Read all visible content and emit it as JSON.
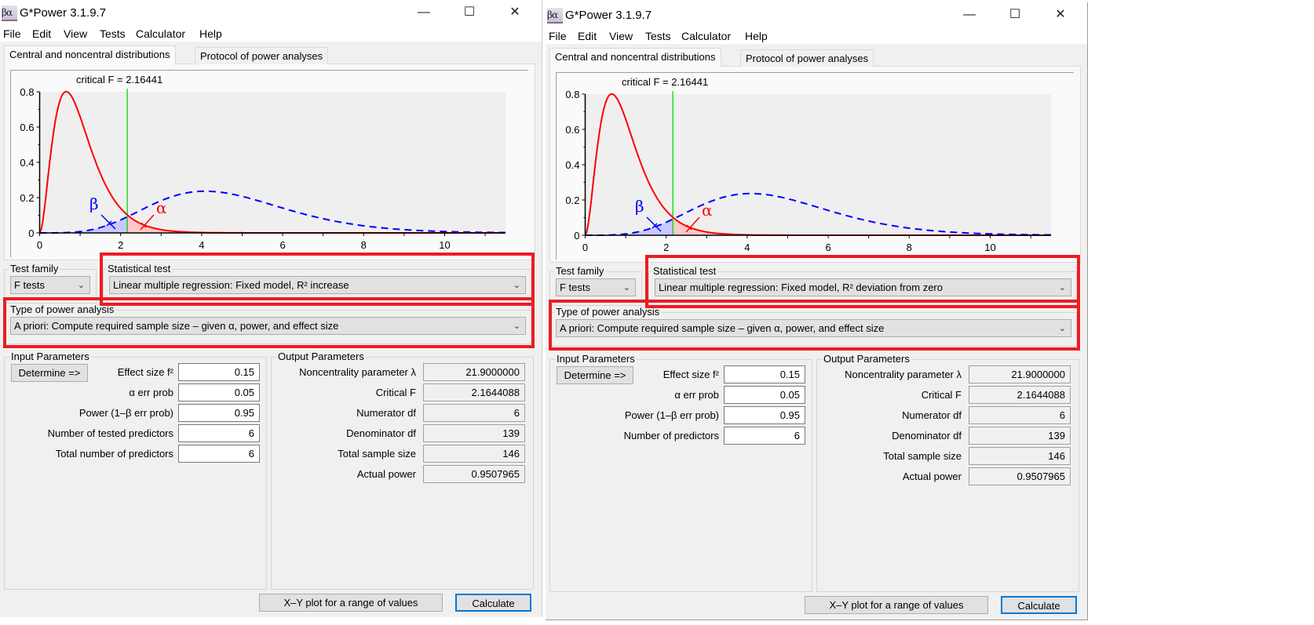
{
  "windows": [
    {
      "title": "G*Power 3.1.9.7",
      "icon_text": "βα",
      "window_buttons": {
        "minimize": "—",
        "maximize": "☐",
        "close": "✕"
      },
      "menu": [
        "File",
        "Edit",
        "View",
        "Tests",
        "Calculator",
        "Help"
      ],
      "tabs": [
        {
          "label": "Central and noncentral distributions",
          "active": true
        },
        {
          "label": "Protocol of power analyses",
          "active": false
        }
      ],
      "critical_label": "critical F =  2.16441",
      "test_family": {
        "label": "Test family",
        "value": "F tests"
      },
      "statistical_test": {
        "label": "Statistical test",
        "value": "Linear multiple regression: Fixed model, R² increase"
      },
      "power_analysis": {
        "label": "Type of power analysis",
        "value": "A priori: Compute required sample size – given α, power, and effect size"
      },
      "input": {
        "label": "Input Parameters",
        "determine": "Determine =>",
        "rows": [
          {
            "label": "Effect size f²",
            "value": "0.15"
          },
          {
            "label": "α err prob",
            "value": "0.05"
          },
          {
            "label": "Power (1–β err prob)",
            "value": "0.95"
          },
          {
            "label": "Number of tested predictors",
            "value": "6"
          },
          {
            "label": "Total number of predictors",
            "value": "6"
          }
        ]
      },
      "output": {
        "label": "Output Parameters",
        "rows": [
          {
            "label": "Noncentrality parameter λ",
            "value": "21.9000000"
          },
          {
            "label": "Critical F",
            "value": "2.1644088"
          },
          {
            "label": "Numerator df",
            "value": "6"
          },
          {
            "label": "Denominator df",
            "value": "139"
          },
          {
            "label": "Total sample size",
            "value": "146"
          },
          {
            "label": "Actual power",
            "value": "0.9507965"
          }
        ]
      },
      "buttons": {
        "xy_plot": "X–Y plot for a range of values",
        "calculate": "Calculate"
      }
    },
    {
      "title": "G*Power 3.1.9.7",
      "icon_text": "βα",
      "window_buttons": {
        "minimize": "—",
        "maximize": "☐",
        "close": "✕"
      },
      "menu": [
        "File",
        "Edit",
        "View",
        "Tests",
        "Calculator",
        "Help"
      ],
      "tabs": [
        {
          "label": "Central and noncentral distributions",
          "active": true
        },
        {
          "label": "Protocol of power analyses",
          "active": false
        }
      ],
      "critical_label": "critical F =  2.16441",
      "test_family": {
        "label": "Test family",
        "value": "F tests"
      },
      "statistical_test": {
        "label": "Statistical test",
        "value": "Linear multiple regression: Fixed model, R² deviation from zero"
      },
      "power_analysis": {
        "label": "Type of power analysis",
        "value": "A priori: Compute required sample size – given α, power, and effect size"
      },
      "input": {
        "label": "Input Parameters",
        "determine": "Determine =>",
        "rows": [
          {
            "label": "Effect size f²",
            "value": "0.15"
          },
          {
            "label": "α err prob",
            "value": "0.05"
          },
          {
            "label": "Power (1–β err prob)",
            "value": "0.95"
          },
          {
            "label": "Number of predictors",
            "value": "6"
          }
        ]
      },
      "output": {
        "label": "Output Parameters",
        "rows": [
          {
            "label": "Noncentrality parameter λ",
            "value": "21.9000000"
          },
          {
            "label": "Critical F",
            "value": "2.1644088"
          },
          {
            "label": "Numerator df",
            "value": "6"
          },
          {
            "label": "Denominator df",
            "value": "139"
          },
          {
            "label": "Total sample size",
            "value": "146"
          },
          {
            "label": "Actual power",
            "value": "0.9507965"
          }
        ]
      },
      "buttons": {
        "xy_plot": "X–Y plot for a range of values",
        "calculate": "Calculate"
      }
    }
  ],
  "chart_data": {
    "type": "line",
    "xlim": [
      0,
      11.5
    ],
    "ylim": [
      0,
      0.8
    ],
    "x_ticks": [
      "0",
      "2",
      "4",
      "6",
      "8",
      "10"
    ],
    "y_ticks": [
      "0",
      "0.2",
      "0.4",
      "0.6",
      "0.8"
    ],
    "critical_value": 2.16441,
    "series": [
      {
        "distribution": "central F",
        "df1": 6,
        "df2": 139,
        "color": "#ff0000",
        "style": "solid",
        "peak": [
          0.66,
          0.8
        ]
      },
      {
        "distribution": "noncentral F",
        "df1": 6,
        "df2": 139,
        "lambda": 21.9,
        "color": "#0000ff",
        "style": "dashed",
        "peak": [
          4.1,
          0.235
        ]
      }
    ],
    "annotations": [
      "β",
      "α"
    ],
    "critical_line_color": "#00dd00",
    "beta_fill": "#c8c8ff",
    "alpha_fill": "#ffc8c8"
  }
}
